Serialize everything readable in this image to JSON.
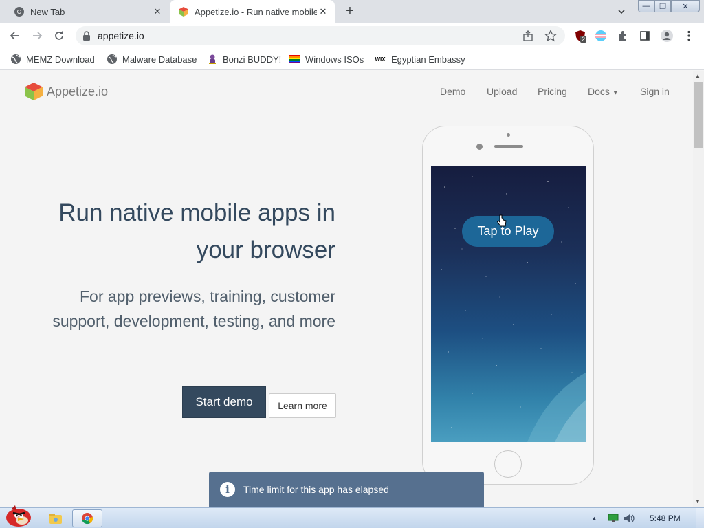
{
  "browser": {
    "tabs": [
      {
        "title": "New Tab",
        "favicon": "chrome-icon",
        "active": false
      },
      {
        "title": "Appetize.io - Run native mobile apps in your browser",
        "favicon": "appetize-cube-icon",
        "active": true
      }
    ],
    "address": "appetize.io",
    "extension_badge": "2",
    "bookmarks": [
      {
        "label": "MEMZ Download",
        "icon": "globe-icon"
      },
      {
        "label": "Malware Database",
        "icon": "globe-icon"
      },
      {
        "label": "Bonzi BUDDY!",
        "icon": "bonzi-icon"
      },
      {
        "label": "Windows ISOs",
        "icon": "rainbow-flag-icon"
      },
      {
        "label": "Egyptian Embassy",
        "icon": "wix-icon"
      }
    ],
    "wix_icon_text": "WIX"
  },
  "page": {
    "brand": "Appetize.io",
    "nav": [
      "Demo",
      "Upload",
      "Pricing",
      "Docs",
      "Sign in"
    ],
    "headline": "Run native mobile apps in your browser",
    "subheadline": "For app previews, training, customer support, development, testing, and more",
    "start_demo": "Start demo",
    "learn_more": "Learn more",
    "tap_to_play": "Tap to Play",
    "toast": "Time limit for this app has elapsed"
  },
  "taskbar": {
    "clock": "5:48 PM"
  },
  "colors": {
    "heading": "#34495e",
    "accent_button": "#34495e",
    "toast_bg": "#56708f"
  }
}
